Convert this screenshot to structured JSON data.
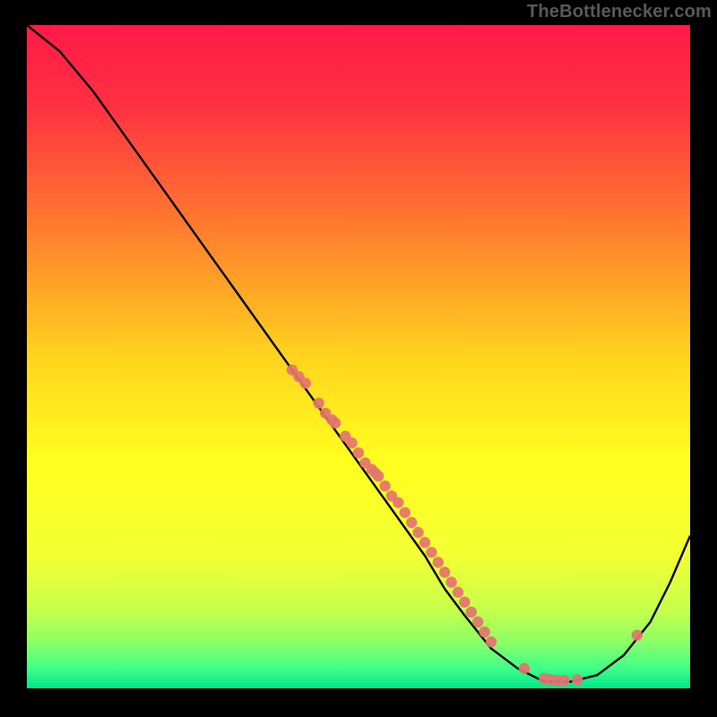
{
  "watermark": "TheBottlenecker.com",
  "chart_data": {
    "type": "line",
    "title": "",
    "xlabel": "",
    "ylabel": "",
    "xlim": [
      0,
      100
    ],
    "ylim": [
      0,
      100
    ],
    "grid": false,
    "background_gradient": {
      "stops": [
        {
          "offset": 0.0,
          "color": "#ff1a47"
        },
        {
          "offset": 0.12,
          "color": "#ff3042"
        },
        {
          "offset": 0.3,
          "color": "#ff7a2e"
        },
        {
          "offset": 0.5,
          "color": "#ffd41e"
        },
        {
          "offset": 0.66,
          "color": "#ffff1f"
        },
        {
          "offset": 0.8,
          "color": "#f3ff33"
        },
        {
          "offset": 0.88,
          "color": "#c8ff4a"
        },
        {
          "offset": 0.93,
          "color": "#8cff66"
        },
        {
          "offset": 0.97,
          "color": "#3fff88"
        },
        {
          "offset": 1.0,
          "color": "#00e58a"
        }
      ]
    },
    "series": [
      {
        "name": "curve",
        "color": "#000000",
        "x": [
          0,
          5,
          10,
          15,
          20,
          25,
          30,
          35,
          40,
          45,
          50,
          55,
          60,
          63,
          66,
          70,
          74,
          78,
          82,
          86,
          90,
          94,
          97,
          100
        ],
        "y": [
          100,
          96,
          90,
          83,
          76,
          69,
          62,
          55,
          48,
          41,
          34,
          27,
          20,
          15,
          11,
          6,
          3,
          1,
          1,
          2,
          5,
          10,
          16,
          23
        ]
      }
    ],
    "points": {
      "name": "markers",
      "color": "#e4736f",
      "x": [
        40,
        41,
        42,
        44,
        45,
        46,
        46.5,
        48,
        49,
        50,
        51,
        52,
        52.5,
        53,
        54,
        55,
        56,
        57,
        58,
        59,
        60,
        61,
        62,
        63,
        64,
        65,
        66,
        67,
        68,
        69,
        70,
        75,
        78,
        79,
        80,
        81,
        83,
        92
      ],
      "y": [
        48,
        47,
        46,
        43,
        41.5,
        40.5,
        40,
        38,
        37,
        35.5,
        34,
        33,
        32.5,
        32,
        30.5,
        29,
        28,
        26.5,
        25,
        23.5,
        22,
        20.5,
        19,
        17.5,
        16,
        14.5,
        13,
        11.5,
        10,
        8.5,
        7,
        3,
        1.5,
        1.3,
        1.2,
        1.2,
        1.3,
        8
      ]
    }
  }
}
